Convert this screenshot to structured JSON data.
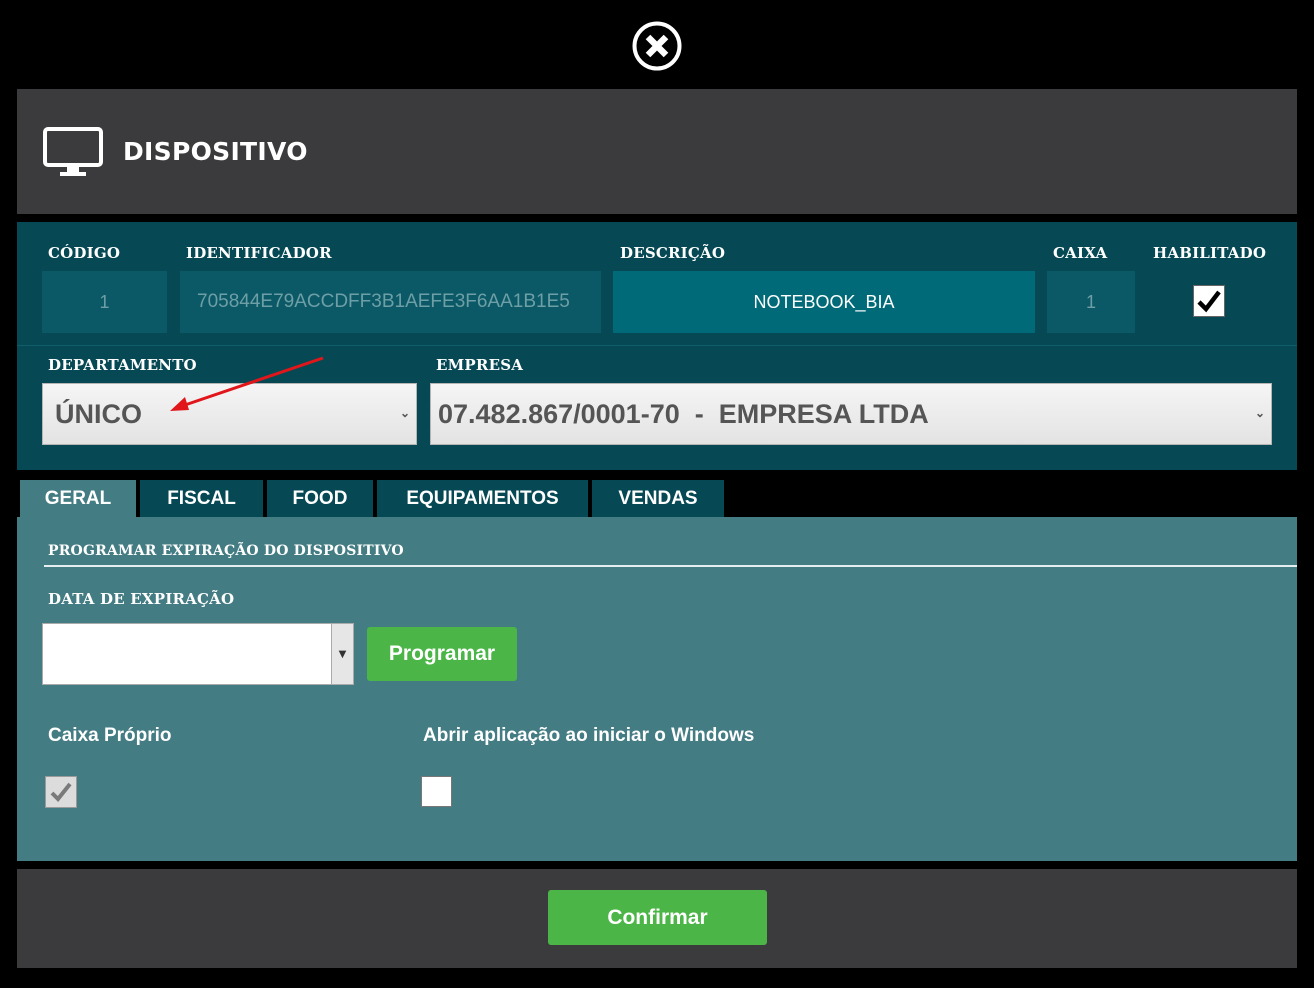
{
  "header": {
    "title": "DISPOSITIVO"
  },
  "info": {
    "labels": {
      "codigo": "CÓDIGO",
      "identificador": "IDENTIFICADOR",
      "descricao": "DESCRIÇÃO",
      "caixa": "CAIXA",
      "habilitado": "HABILITADO",
      "departamento": "DEPARTAMENTO",
      "empresa": "EMPRESA"
    },
    "values": {
      "codigo": "1",
      "identificador": "705844E79ACCDFF3B1AEFE3F6AA1B1E5",
      "descricao": "NOTEBOOK_BIA",
      "caixa": "1",
      "habilitado": true,
      "departamento": "ÚNICO",
      "empresa": "07.482.867/0001-70  -  EMPRESA LTDA"
    }
  },
  "tabs": [
    {
      "label": "GERAL",
      "active": true
    },
    {
      "label": "FISCAL",
      "active": false
    },
    {
      "label": "FOOD",
      "active": false
    },
    {
      "label": "EQUIPAMENTOS",
      "active": false
    },
    {
      "label": "VENDAS",
      "active": false
    }
  ],
  "geral": {
    "section_title": "PROGRAMAR EXPIRAÇÃO DO DISPOSITIVO",
    "date_label": "DATA DE EXPIRAÇÃO",
    "date_value": "",
    "program_button": "Programar",
    "caixa_proprio_label": "Caixa Próprio",
    "caixa_proprio_checked": true,
    "abrir_label": "Abrir aplicação ao iniciar o Windows",
    "abrir_checked": false
  },
  "footer": {
    "confirm_button": "Confirmar"
  },
  "colors": {
    "header_bg": "#3b3b3d",
    "info_bg": "#064954",
    "panel_bg": "#437c83",
    "accent_green": "#4bb647",
    "arrow_red": "#e0161b"
  },
  "icons": [
    "close-icon",
    "monitor-icon",
    "checkmark-icon",
    "chevron-down-icon"
  ]
}
